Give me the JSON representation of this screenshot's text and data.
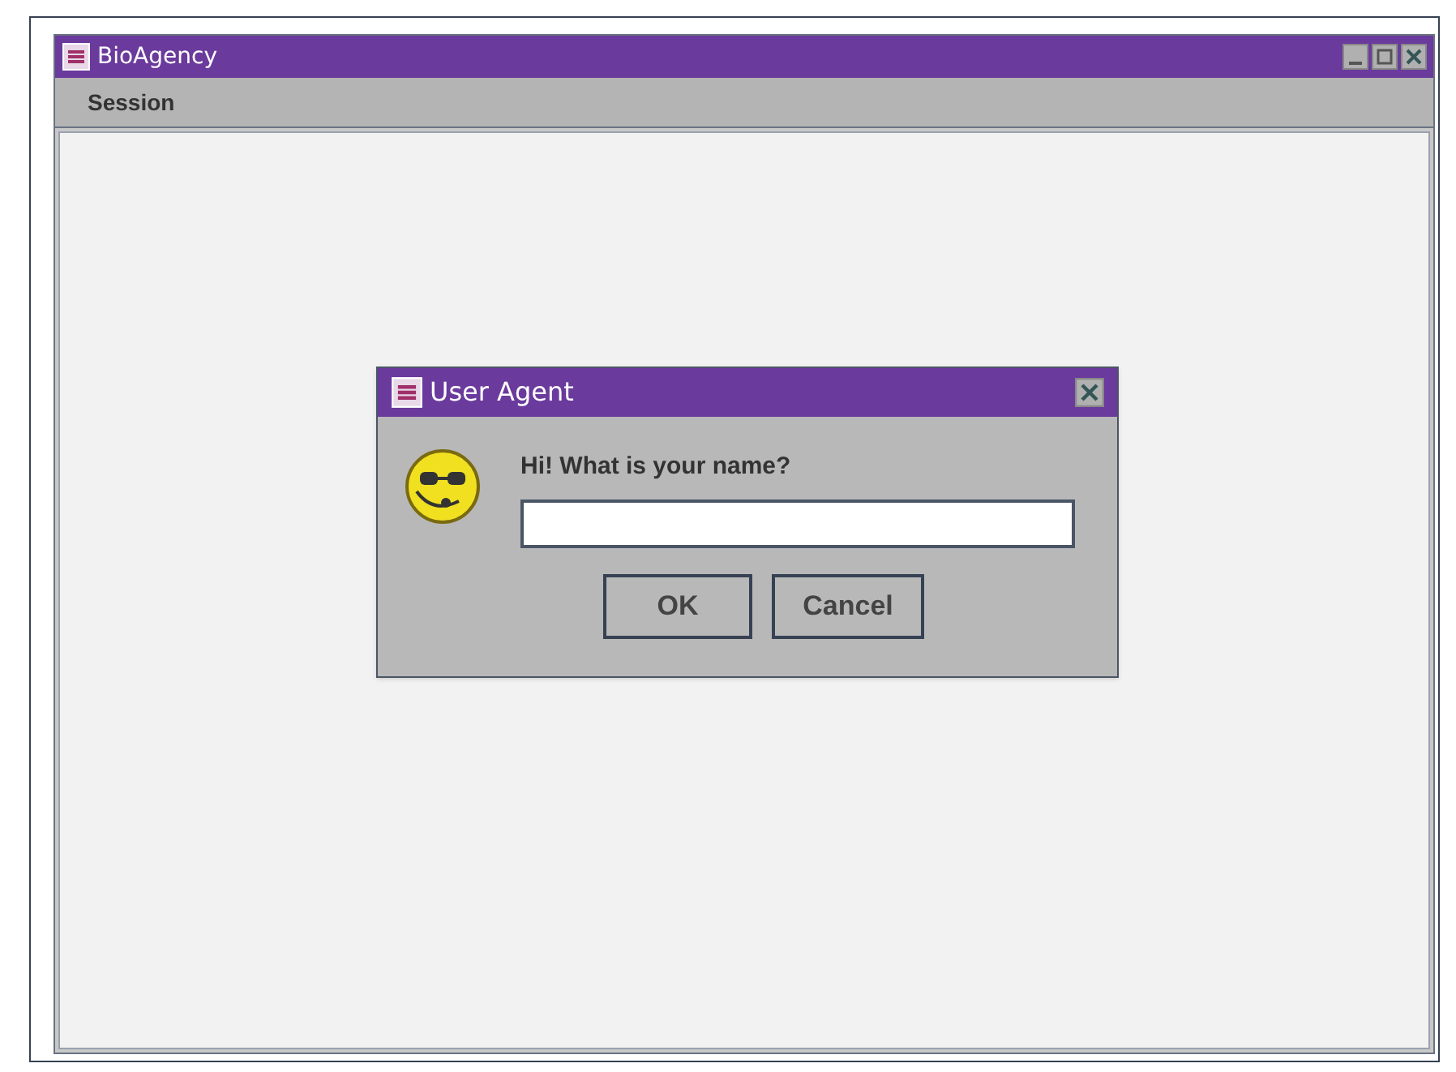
{
  "window": {
    "title": "BioAgency"
  },
  "menu": [
    "Session"
  ],
  "dialog": {
    "title": "User Agent",
    "prompt": "Hi! What is your name?",
    "buttons": [
      "OK",
      "Cancel"
    ]
  }
}
